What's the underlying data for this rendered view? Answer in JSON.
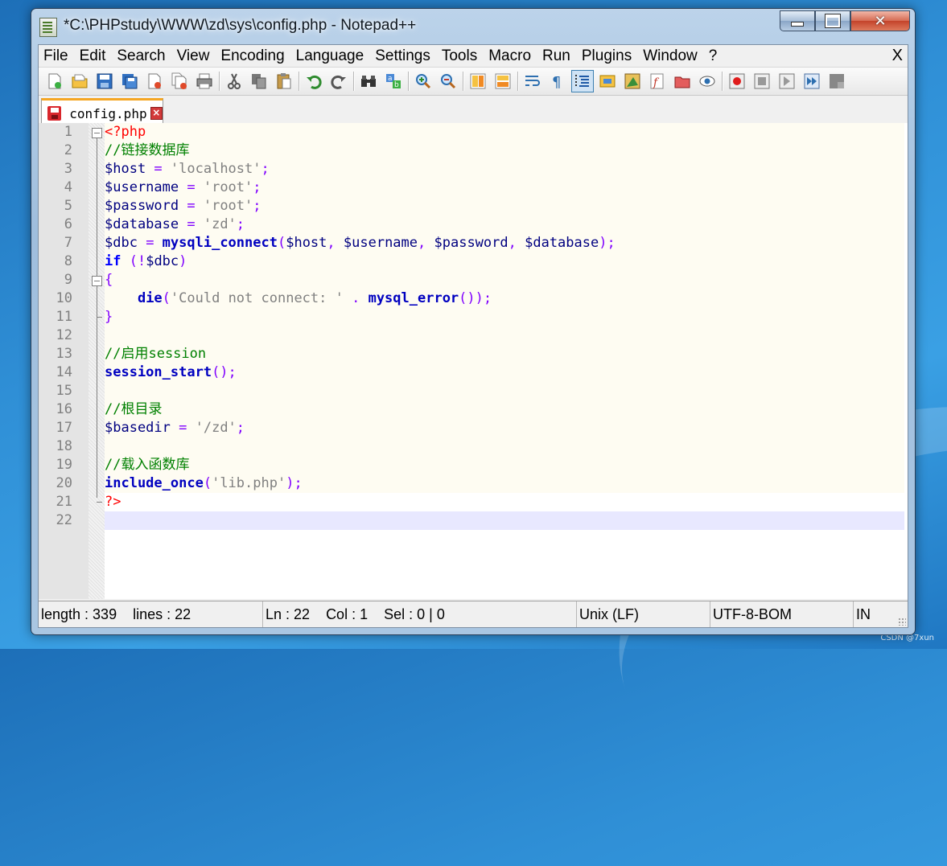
{
  "window": {
    "title": "*C:\\PHPstudy\\WWW\\zd\\sys\\config.php - Notepad++"
  },
  "menu": {
    "items": [
      "File",
      "Edit",
      "Search",
      "View",
      "Encoding",
      "Language",
      "Settings",
      "Tools",
      "Macro",
      "Run",
      "Plugins",
      "Window",
      "?"
    ],
    "close_label": "X"
  },
  "toolbar": {
    "icons": [
      "new-file-icon",
      "open-file-icon",
      "save-icon",
      "save-all-icon",
      "close-icon",
      "close-all-icon",
      "print-icon",
      "cut-icon",
      "copy-icon",
      "paste-icon",
      "undo-icon",
      "redo-icon",
      "find-icon",
      "replace-icon",
      "zoom-in-icon",
      "zoom-out-icon",
      "sync-vertical-icon",
      "sync-horizontal-icon",
      "word-wrap-icon",
      "show-all-characters-icon",
      "indent-guide-icon",
      "language-icon",
      "document-map-icon",
      "function-list-icon",
      "folder-as-workspace-icon",
      "monitoring-icon",
      "record-macro-icon",
      "stop-macro-icon",
      "play-macro-icon",
      "run-macro-multiple-icon",
      "save-macro-icon"
    ]
  },
  "tab": {
    "label": "config.php"
  },
  "editor": {
    "line_numbers": [
      "1",
      "2",
      "3",
      "4",
      "5",
      "6",
      "7",
      "8",
      "9",
      "10",
      "11",
      "12",
      "13",
      "14",
      "15",
      "16",
      "17",
      "18",
      "19",
      "20",
      "21",
      "22"
    ],
    "lines": [
      [
        {
          "t": "tag",
          "v": "<?php"
        }
      ],
      [
        {
          "t": "com",
          "v": "//链接数据库"
        }
      ],
      [
        {
          "t": "var",
          "v": "$host"
        },
        {
          "t": "op",
          "v": " = "
        },
        {
          "t": "str",
          "v": "'localhost'"
        },
        {
          "t": "op",
          "v": ";"
        }
      ],
      [
        {
          "t": "var",
          "v": "$username"
        },
        {
          "t": "op",
          "v": " = "
        },
        {
          "t": "str",
          "v": "'root'"
        },
        {
          "t": "op",
          "v": ";"
        }
      ],
      [
        {
          "t": "var",
          "v": "$password"
        },
        {
          "t": "op",
          "v": " = "
        },
        {
          "t": "str",
          "v": "'root'"
        },
        {
          "t": "op",
          "v": ";"
        }
      ],
      [
        {
          "t": "var",
          "v": "$database"
        },
        {
          "t": "op",
          "v": " = "
        },
        {
          "t": "str",
          "v": "'zd'"
        },
        {
          "t": "op",
          "v": ";"
        }
      ],
      [
        {
          "t": "var",
          "v": "$dbc"
        },
        {
          "t": "op",
          "v": " = "
        },
        {
          "t": "fn",
          "v": "mysqli_connect"
        },
        {
          "t": "op",
          "v": "("
        },
        {
          "t": "var",
          "v": "$host"
        },
        {
          "t": "op",
          "v": ", "
        },
        {
          "t": "var",
          "v": "$username"
        },
        {
          "t": "op",
          "v": ", "
        },
        {
          "t": "var",
          "v": "$password"
        },
        {
          "t": "op",
          "v": ", "
        },
        {
          "t": "var",
          "v": "$database"
        },
        {
          "t": "op",
          "v": ");"
        }
      ],
      [
        {
          "t": "kw",
          "v": "if"
        },
        {
          "t": "op",
          "v": " (!"
        },
        {
          "t": "var",
          "v": "$dbc"
        },
        {
          "t": "op",
          "v": ")"
        }
      ],
      [
        {
          "t": "op",
          "v": "{"
        }
      ],
      [
        {
          "t": "plain",
          "v": "    "
        },
        {
          "t": "fn",
          "v": "die"
        },
        {
          "t": "op",
          "v": "("
        },
        {
          "t": "str",
          "v": "'Could not connect: '"
        },
        {
          "t": "op",
          "v": " . "
        },
        {
          "t": "fn",
          "v": "mysql_error"
        },
        {
          "t": "op",
          "v": "());"
        }
      ],
      [
        {
          "t": "op",
          "v": "}"
        }
      ],
      [],
      [
        {
          "t": "com",
          "v": "//启用session"
        }
      ],
      [
        {
          "t": "fn",
          "v": "session_start"
        },
        {
          "t": "op",
          "v": "();"
        }
      ],
      [],
      [
        {
          "t": "com",
          "v": "//根目录"
        }
      ],
      [
        {
          "t": "var",
          "v": "$basedir"
        },
        {
          "t": "op",
          "v": " = "
        },
        {
          "t": "str",
          "v": "'/zd'"
        },
        {
          "t": "op",
          "v": ";"
        }
      ],
      [],
      [
        {
          "t": "com",
          "v": "//载入函数库"
        }
      ],
      [
        {
          "t": "fn",
          "v": "include_once"
        },
        {
          "t": "op",
          "v": "("
        },
        {
          "t": "str",
          "v": "'lib.php'"
        },
        {
          "t": "op",
          "v": ");"
        }
      ],
      [
        {
          "t": "tag",
          "v": "?>"
        }
      ],
      []
    ]
  },
  "status": {
    "length": "length : 339",
    "lines": "lines : 22",
    "ln": "Ln : 22",
    "col": "Col : 1",
    "sel": "Sel : 0 | 0",
    "eol": "Unix (LF)",
    "encoding": "UTF-8-BOM",
    "mode": "IN"
  },
  "watermark": "CSDN @7xun",
  "colors": {
    "tag": "#ff0000",
    "comment": "#008000",
    "variable": "#000080",
    "operator": "#8000ff",
    "string": "#808080",
    "function": "#0000c0",
    "keyword": "#0000ff",
    "current_line": "#e8e8ff"
  }
}
